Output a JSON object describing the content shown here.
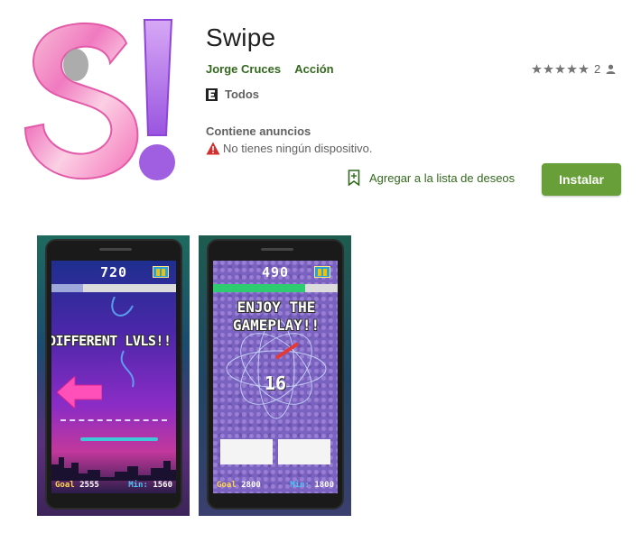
{
  "app": {
    "title": "Swipe",
    "developer": "Jorge Cruces",
    "category": "Acción",
    "rating_count": "2",
    "content_rating": "Todos",
    "ads_notice": "Contiene anuncios",
    "device_warning": "No tienes ningún dispositivo.",
    "wishlist_label": "Agregar a la lista de deseos",
    "install_label": "Instalar"
  },
  "colors": {
    "accent_green": "#689f38",
    "link_green": "#33691e",
    "warning_red": "#d32f2f"
  },
  "screenshots": [
    {
      "score": "720",
      "caption": "DIFFERENT LVLS!!",
      "goal_label": "Goal",
      "goal_value": "2555",
      "min_label": "Min:",
      "min_value": "1560",
      "progress_fraction": 0.25
    },
    {
      "score": "490",
      "caption": "ENJOY THE GAMEPLAY!!",
      "center_number": "16",
      "goal_label": "Goal",
      "goal_value": "2800",
      "min_label": "Min:",
      "min_value": "1800",
      "progress_fraction": 0.74
    }
  ]
}
